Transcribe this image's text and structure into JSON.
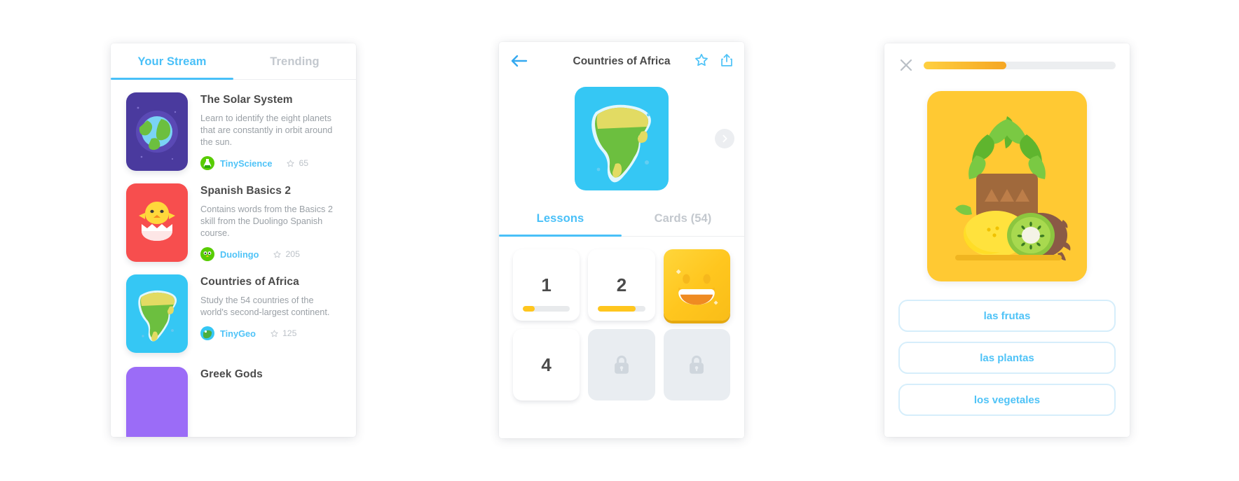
{
  "stream_panel": {
    "tabs": [
      {
        "label": "Your Stream",
        "active": true
      },
      {
        "label": "Trending",
        "active": false
      }
    ],
    "items": [
      {
        "title": "The Solar System",
        "description": "Learn to identify the eight planets that are constantly in orbit around the sun.",
        "author": "TinyScience",
        "stars": "65",
        "thumb_icon": "earth-planet-icon",
        "thumb_color": "#4a3a9e",
        "avatar_color": "#58cc02"
      },
      {
        "title": "Spanish Basics 2",
        "description": "Contains words from the Basics 2 skill from the Duolingo Spanish course.",
        "author": "Duolingo",
        "stars": "205",
        "thumb_icon": "chick-egg-icon",
        "thumb_color": "#f74e4e",
        "avatar_color": "#58cc02"
      },
      {
        "title": "Countries of Africa",
        "description": "Study the 54 countries of the world's second-largest continent.",
        "author": "TinyGeo",
        "stars": "125",
        "thumb_icon": "africa-map-icon",
        "thumb_color": "#35c7f4",
        "avatar_color": "#35c7f4"
      },
      {
        "title": "Greek Gods",
        "description": "",
        "author": "",
        "stars": "",
        "thumb_icon": "greek-icon",
        "thumb_color": "#9b6cf7",
        "avatar_color": "#9b6cf7"
      }
    ]
  },
  "deck_panel": {
    "title": "Countries of Africa",
    "back_icon": "back-arrow-icon",
    "favorite_icon": "star-outline-icon",
    "share_icon": "share-icon",
    "next_icon": "chevron-right-icon",
    "hero_icon": "africa-map-icon",
    "tabs": [
      {
        "label": "Lessons",
        "active": true
      },
      {
        "label": "Cards (54)",
        "active": false
      }
    ],
    "lessons": [
      {
        "label": "1",
        "state": "progress",
        "progress": 25
      },
      {
        "label": "2",
        "state": "progress",
        "progress": 80
      },
      {
        "label": "",
        "state": "gold",
        "progress": 0
      },
      {
        "label": "4",
        "state": "plain",
        "progress": 0
      },
      {
        "label": "",
        "state": "locked",
        "progress": 0
      },
      {
        "label": "",
        "state": "locked",
        "progress": 0
      }
    ]
  },
  "quiz_panel": {
    "close_icon": "close-icon",
    "progress": 43,
    "image_icon": "fruits-illustration",
    "answers": [
      {
        "label": "las frutas"
      },
      {
        "label": "las plantas"
      },
      {
        "label": "los vegetales"
      }
    ]
  },
  "colors": {
    "accent_blue": "#4fc3f7",
    "accent_yellow": "#ffc61e",
    "green": "#58cc02",
    "text_dark": "#4b4b4b",
    "text_muted": "#9aa0a6"
  }
}
